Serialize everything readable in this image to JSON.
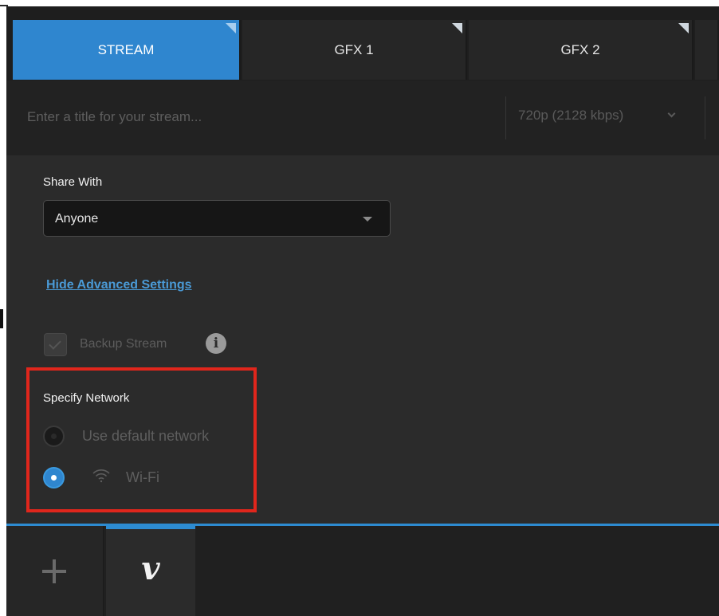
{
  "tabs": [
    {
      "label": "STREAM",
      "active": true
    },
    {
      "label": "GFX 1",
      "active": false
    },
    {
      "label": "GFX 2",
      "active": false
    }
  ],
  "title_bar": {
    "placeholder": "Enter a title for your stream...",
    "value": "",
    "quality": "720p (2128 kbps)"
  },
  "settings": {
    "share_label": "Share With",
    "share_value": "Anyone",
    "advanced_link": "Hide Advanced Settings",
    "backup_label": "Backup Stream",
    "backup_checked": true,
    "backup_enabled": false
  },
  "network": {
    "heading": "Specify Network",
    "options": [
      {
        "label": "Use default network",
        "selected": false
      },
      {
        "label": "Wi-Fi",
        "icon": "wifi-icon",
        "selected": true
      }
    ]
  },
  "dock": {
    "add_icon": "plus-icon",
    "destination_icon": "vimeo-logo-icon",
    "destination_glyph": "v"
  },
  "colors": {
    "accent": "#2f86cf",
    "highlight_box": "#e0261c",
    "panel_bg": "#2b2b2b",
    "link": "#4a9ad6"
  }
}
